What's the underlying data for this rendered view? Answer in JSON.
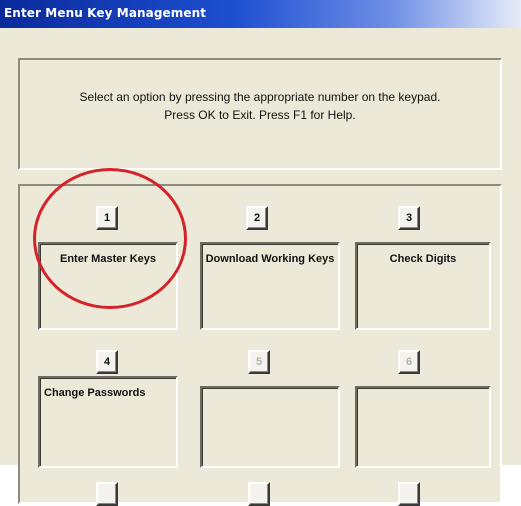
{
  "window": {
    "title": "Enter Menu Key Management"
  },
  "instructions": {
    "line1": "Select an option by pressing the appropriate number on the keypad.",
    "line2": "Press OK to Exit. Press F1 for Help."
  },
  "options": [
    {
      "key": "1",
      "label": "Enter Master Keys"
    },
    {
      "key": "2",
      "label": "Download Working Keys"
    },
    {
      "key": "3",
      "label": "Check Digits"
    },
    {
      "key": "4",
      "label": "Change Passwords"
    },
    {
      "key": "5",
      "label": ""
    },
    {
      "key": "6",
      "label": ""
    }
  ],
  "colors": {
    "titlebar": "#0a2a9c",
    "highlight_circle": "#d4232b",
    "panel": "#ece9d8"
  }
}
